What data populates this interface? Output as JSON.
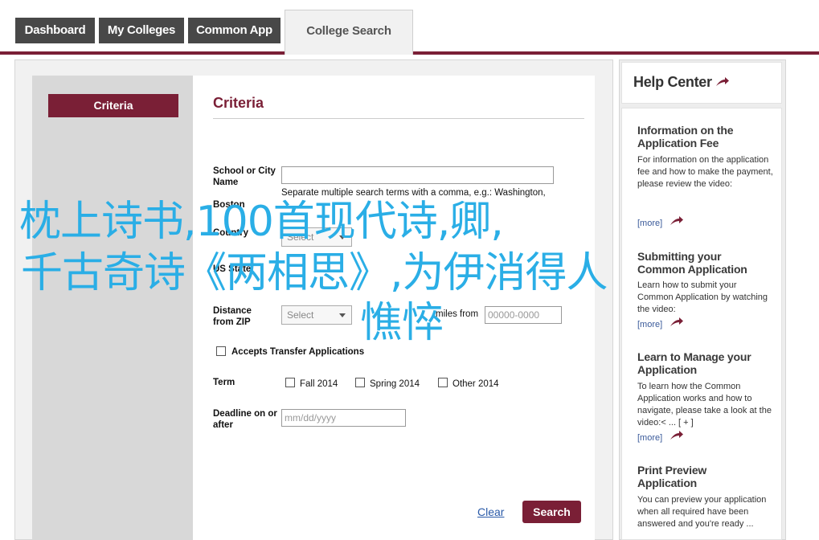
{
  "tabs": [
    {
      "label": "Dashboard"
    },
    {
      "label": "My Colleges"
    },
    {
      "label": "Common App"
    },
    {
      "label": "College Search"
    }
  ],
  "sidebar": {
    "criteria_label": "Criteria"
  },
  "form": {
    "title": "Criteria",
    "school_city_label": "School or City Name",
    "school_city_value": "",
    "school_city_hint": "Separate multiple search terms with a comma, e.g.: Washington,",
    "boston_fragment": "Boston",
    "country_label": "Country",
    "country_select": "Select",
    "state_label": "US State",
    "distance_label": "Distance from ZIP",
    "distance_select": "Select",
    "miles_from_label": "miles from",
    "zip_placeholder": "00000-0000",
    "transfer_label": "Accepts Transfer Applications",
    "term_label": "Term",
    "terms": [
      "Fall 2014",
      "Spring 2014",
      "Other 2014"
    ],
    "deadline_label": "Deadline on or after",
    "deadline_placeholder": "mm/dd/yyyy",
    "clear_label": "Clear",
    "search_label": "Search"
  },
  "help": {
    "title": "Help Center",
    "items": [
      {
        "title": "Information on the Application Fee",
        "desc": "For information on the application fee and how to make the payment, please review the video:",
        "more": "[more]"
      },
      {
        "title": "Submitting your Common Application",
        "desc": "Learn how to submit your Common Application by watching the video:",
        "more": "[more]"
      },
      {
        "title": "Learn to Manage your Application",
        "desc": "To learn how the Common Application works and how to navigate, please take a look at the video:< ... [ + ]",
        "more": "[more]"
      },
      {
        "title": "Print Preview Application",
        "desc": "You can preview your application when all required have been answered and you're ready ...",
        "more": ""
      }
    ]
  },
  "overlay": {
    "line1": "枕上诗书,100首现代诗,卿,",
    "line2": "千古奇诗《两相思》,为伊消得人",
    "line3": "憔悴"
  },
  "colors": {
    "brand": "#7a1f36",
    "tab_dark": "#484848",
    "overlay": "#2aaee6",
    "link": "#2a5aa8"
  }
}
